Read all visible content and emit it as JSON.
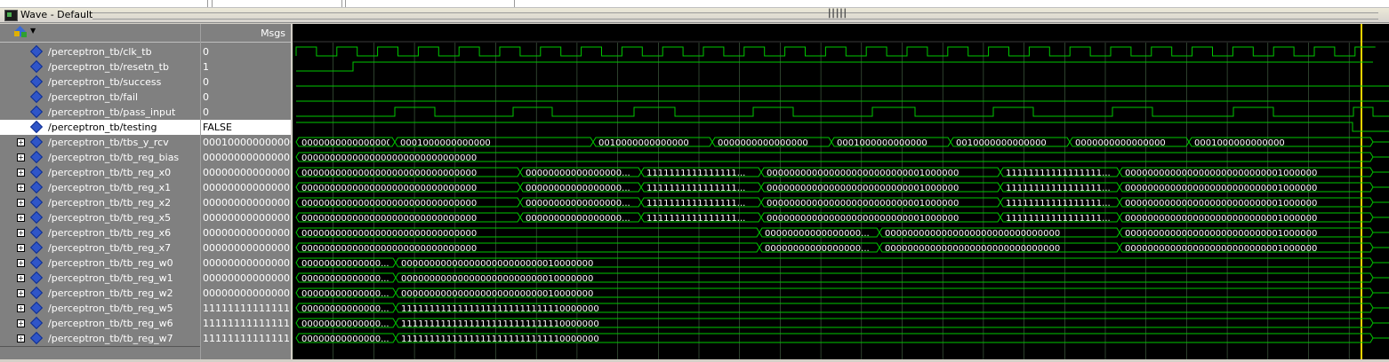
{
  "window": {
    "title": "Wave - Default"
  },
  "msgs_header": "Msgs",
  "signals": [
    {
      "name": "/perceptron_tb/clk_tb",
      "value": "0",
      "expandable": false,
      "selected": false
    },
    {
      "name": "/perceptron_tb/resetn_tb",
      "value": "1",
      "expandable": false,
      "selected": false
    },
    {
      "name": "/perceptron_tb/success",
      "value": "0",
      "expandable": false,
      "selected": false
    },
    {
      "name": "/perceptron_tb/fail",
      "value": "0",
      "expandable": false,
      "selected": false
    },
    {
      "name": "/perceptron_tb/pass_input",
      "value": "0",
      "expandable": false,
      "selected": false
    },
    {
      "name": "/perceptron_tb/testing",
      "value": "FALSE",
      "expandable": false,
      "selected": true
    },
    {
      "name": "/perceptron_tb/tbs_y_rcv",
      "value": "0001000000000000",
      "expandable": true,
      "selected": false
    },
    {
      "name": "/perceptron_tb/tb_reg_bias",
      "value": "00000000000000...",
      "expandable": true,
      "selected": false
    },
    {
      "name": "/perceptron_tb/tb_reg_x0",
      "value": "00000000000000...",
      "expandable": true,
      "selected": false
    },
    {
      "name": "/perceptron_tb/tb_reg_x1",
      "value": "00000000000000...",
      "expandable": true,
      "selected": false
    },
    {
      "name": "/perceptron_tb/tb_reg_x2",
      "value": "00000000000000...",
      "expandable": true,
      "selected": false
    },
    {
      "name": "/perceptron_tb/tb_reg_x5",
      "value": "00000000000000...",
      "expandable": true,
      "selected": false
    },
    {
      "name": "/perceptron_tb/tb_reg_x6",
      "value": "00000000000000...",
      "expandable": true,
      "selected": false
    },
    {
      "name": "/perceptron_tb/tb_reg_x7",
      "value": "00000000000000...",
      "expandable": true,
      "selected": false
    },
    {
      "name": "/perceptron_tb/tb_reg_w0",
      "value": "00000000000000...",
      "expandable": true,
      "selected": false
    },
    {
      "name": "/perceptron_tb/tb_reg_w1",
      "value": "00000000000000...",
      "expandable": true,
      "selected": false
    },
    {
      "name": "/perceptron_tb/tb_reg_w2",
      "value": "00000000000000...",
      "expandable": true,
      "selected": false
    },
    {
      "name": "/perceptron_tb/tb_reg_w5",
      "value": "11111111111111...",
      "expandable": true,
      "selected": false
    },
    {
      "name": "/perceptron_tb/tb_reg_w6",
      "value": "11111111111111...",
      "expandable": true,
      "selected": false
    },
    {
      "name": "/perceptron_tb/tb_reg_w7",
      "value": "11111111111111...",
      "expandable": true,
      "selected": false
    }
  ],
  "wave_segments": {
    "tbs_y_rcv": [
      "0000000000000000",
      "0001000000000000",
      "0010000000000000",
      "0000000000000000",
      "0001000000000000",
      "0010000000000000",
      "0000000000000000",
      "0001000000000000"
    ],
    "tb_reg_bias": [
      "0000000000000000000000000000000"
    ],
    "tb_reg_x0": [
      "0000000000000000000000000000000",
      "00000000000000000...",
      "1111111111111111...",
      "0000000000000000000000000001000000",
      "11111111111111111...",
      "0000000000000000000000000001000000"
    ],
    "tb_reg_x1": [
      "0000000000000000000000000000000",
      "00000000000000000...",
      "1111111111111111...",
      "0000000000000000000000000001000000",
      "11111111111111111...",
      "0000000000000000000000000001000000"
    ],
    "tb_reg_x2": [
      "0000000000000000000000000000000",
      "00000000000000000...",
      "1111111111111111...",
      "0000000000000000000000000001000000",
      "11111111111111111...",
      "0000000000000000000000000001000000"
    ],
    "tb_reg_x5": [
      "0000000000000000000000000000000",
      "00000000000000000...",
      "1111111111111111...",
      "0000000000000000000000000001000000",
      "11111111111111111...",
      "0000000000000000000000000001000000"
    ],
    "tb_reg_x6": [
      "0000000000000000000000000000000",
      "00000000000000000...",
      "0000000000000000000000000000000",
      "0000000000000000000000000001000000"
    ],
    "tb_reg_x7": [
      "0000000000000000000000000000000",
      "00000000000000000...",
      "0000000000000000000000000000000",
      "0000000000000000000000000001000000"
    ],
    "tb_reg_w0": [
      "00000000000000...",
      "0000000000000000000000000010000000"
    ],
    "tb_reg_w1": [
      "00000000000000...",
      "0000000000000000000000000010000000"
    ],
    "tb_reg_w2": [
      "00000000000000...",
      "0000000000000000000000000010000000"
    ],
    "tb_reg_w5": [
      "00000000000000...",
      "11111111111111111111111111110000000"
    ],
    "tb_reg_w6": [
      "00000000000000...",
      "11111111111111111111111111110000000"
    ],
    "tb_reg_w7": [
      "00000000000000...",
      "11111111111111111111111111110000000"
    ]
  },
  "colors": {
    "wave": "#00c800",
    "grid": "#4a6a4a",
    "cursor": "#ffd400",
    "text": "#ffffff",
    "background": "#000000"
  }
}
